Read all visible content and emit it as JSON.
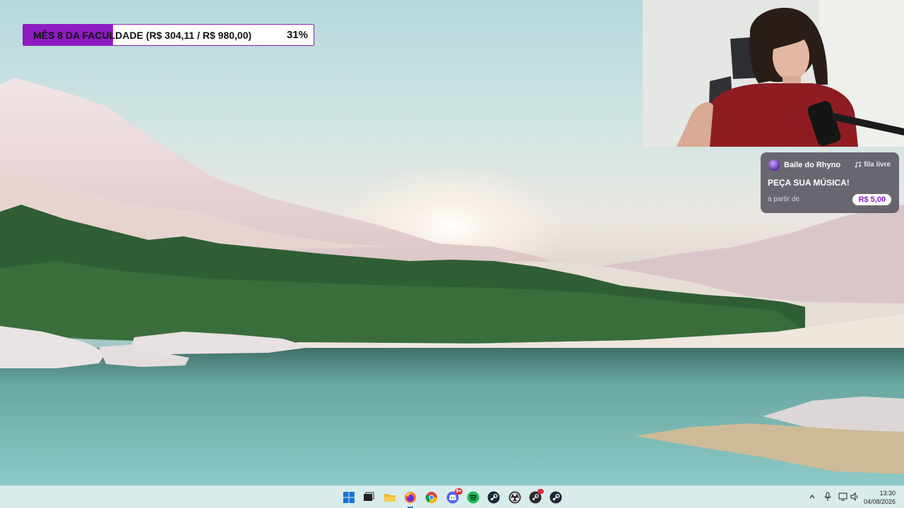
{
  "goal": {
    "text": "MÊS 8 DA FACULDADE (R$ 304,11 / R$ 980,00)",
    "percent_label": "31%",
    "progress": 0.31,
    "fill_color": "#8e1bc1"
  },
  "song_widget": {
    "channel": "Baile do Rhyno",
    "queue_label": "fila livre",
    "headline": "PEÇA SUA MÚSICA!",
    "price_prefix": "a partir de",
    "price": "R$ 5,00"
  },
  "taskbar": {
    "apps": [
      {
        "name": "start",
        "icon": "windows-start-icon"
      },
      {
        "name": "task-view",
        "icon": "task-view-icon"
      },
      {
        "name": "file-explorer",
        "icon": "folder-icon"
      },
      {
        "name": "firefox",
        "icon": "firefox-icon",
        "active": true
      },
      {
        "name": "chrome",
        "icon": "chrome-icon"
      },
      {
        "name": "discord",
        "icon": "discord-icon",
        "badge": "9+"
      },
      {
        "name": "spotify",
        "icon": "spotify-icon"
      },
      {
        "name": "steam",
        "icon": "steam-icon"
      },
      {
        "name": "obs",
        "icon": "obs-icon"
      },
      {
        "name": "steam-notify",
        "icon": "steam-icon"
      },
      {
        "name": "steam-2",
        "icon": "steam-icon"
      }
    ],
    "tray": [
      "chevron-up-icon",
      "microphone-icon",
      "monitor-icon",
      "speaker-icon"
    ],
    "time": "13:30",
    "date": "04/08/2026"
  }
}
